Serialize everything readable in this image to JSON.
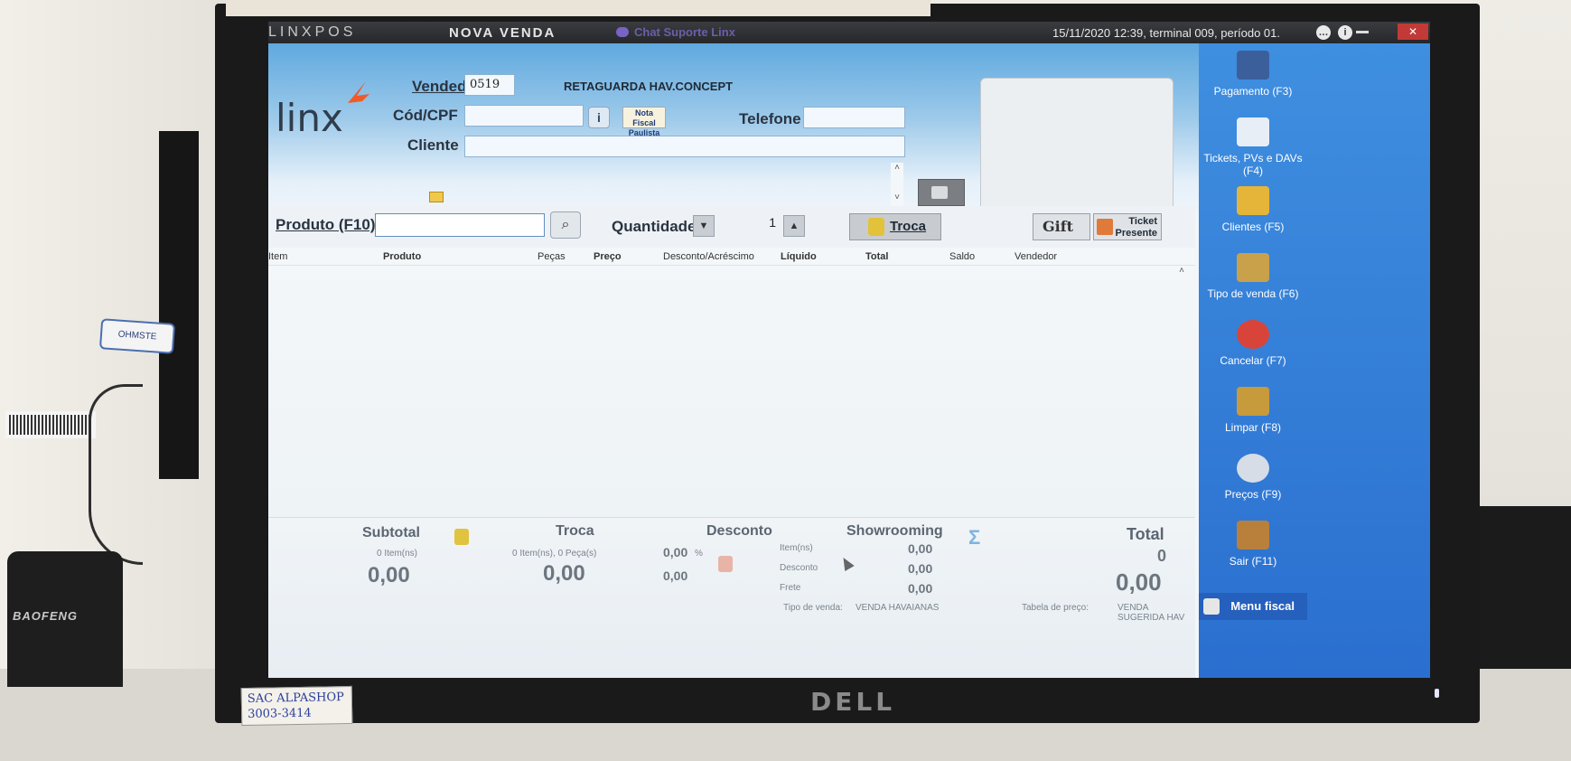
{
  "titlebar": {
    "brand": "LINXPOS",
    "window_title": "NOVA VENDA",
    "chat_label": "Chat Suporte Linx",
    "status": "15/11/2020 12:39, terminal 009, período 01.",
    "close_label": "✕",
    "info_label": "i"
  },
  "header": {
    "logo": "linx",
    "vendedor_label": "Vendedor",
    "vendedor_value": "0519",
    "company": "RETAGUARDA HAV.CONCEPT",
    "cpf_label": "Cód/CPF",
    "cpf_value": "",
    "nota_label": "Nota Fiscal Paulista",
    "telefone_label": "Telefone",
    "telefone_value": "",
    "cliente_label": "Cliente",
    "cliente_value": ""
  },
  "search": {
    "produto_label": "Produto (F10)",
    "produto_value": "",
    "quantidade_label": "Quantidade",
    "quantidade_value": "1",
    "troca_label": "Troca",
    "gift_label": "Gift",
    "ticket_label_1": "Ticket",
    "ticket_label_2": "Presente"
  },
  "grid": {
    "columns": [
      "Item",
      "Produto",
      "Peças",
      "Preço",
      "Desconto/Acréscimo",
      "Líquido",
      "Total",
      "Saldo",
      "Vendedor"
    ]
  },
  "totals": {
    "subtotal_title": "Subtotal",
    "subtotal_items": "0 Item(ns)",
    "subtotal_value": "0,00",
    "troca_title": "Troca",
    "troca_items": "0 Item(ns), 0 Peça(s)",
    "troca_value": "0,00",
    "desconto_title": "Desconto",
    "desconto_pct": "0,00",
    "desconto_pct_sign": "%",
    "desconto_value": "0,00",
    "showrooming_title": "Showrooming",
    "show_items_label": "Item(ns)",
    "show_items_value": "0,00",
    "show_desconto_label": "Desconto",
    "show_desconto_value": "0,00",
    "show_frete_label": "Frete",
    "show_frete_value": "0,00",
    "total_title": "Total",
    "total_count": "0",
    "total_value": "0,00",
    "tipo_venda_label": "Tipo de venda:",
    "tipo_venda_value": "VENDA HAVAIANAS",
    "tabela_label": "Tabela de preço:",
    "tabela_value": "VENDA SUGERIDA HAV"
  },
  "sidebar": {
    "items": [
      {
        "label": "Pagamento (F3)",
        "icon": "payment-icon",
        "color": "#3b5f9a"
      },
      {
        "label": "Tickets, PVs e DAVs (F4)",
        "icon": "tickets-icon",
        "color": "#e8eef5"
      },
      {
        "label": "Clientes (F5)",
        "icon": "clients-icon",
        "color": "#e5b53a"
      },
      {
        "label": "Tipo de venda (F6)",
        "icon": "sale-type-icon",
        "color": "#c9a14a"
      },
      {
        "label": "Cancelar (F7)",
        "icon": "cancel-icon",
        "color": "#d9443a"
      },
      {
        "label": "Limpar (F8)",
        "icon": "broom-icon",
        "color": "#c79a3c"
      },
      {
        "label": "Preços (F9)",
        "icon": "prices-icon",
        "color": "#d6dde6"
      },
      {
        "label": "Sair (F11)",
        "icon": "exit-icon",
        "color": "#b9803c"
      }
    ],
    "menu_fiscal": "Menu fiscal"
  },
  "environment": {
    "monitor_brand": "DELL",
    "sticker_line1": "SAC ALPASHOP",
    "sticker_line2": "3003-3414",
    "radio_brand": "BAOFENG",
    "usb_label": "OHMSTE"
  }
}
